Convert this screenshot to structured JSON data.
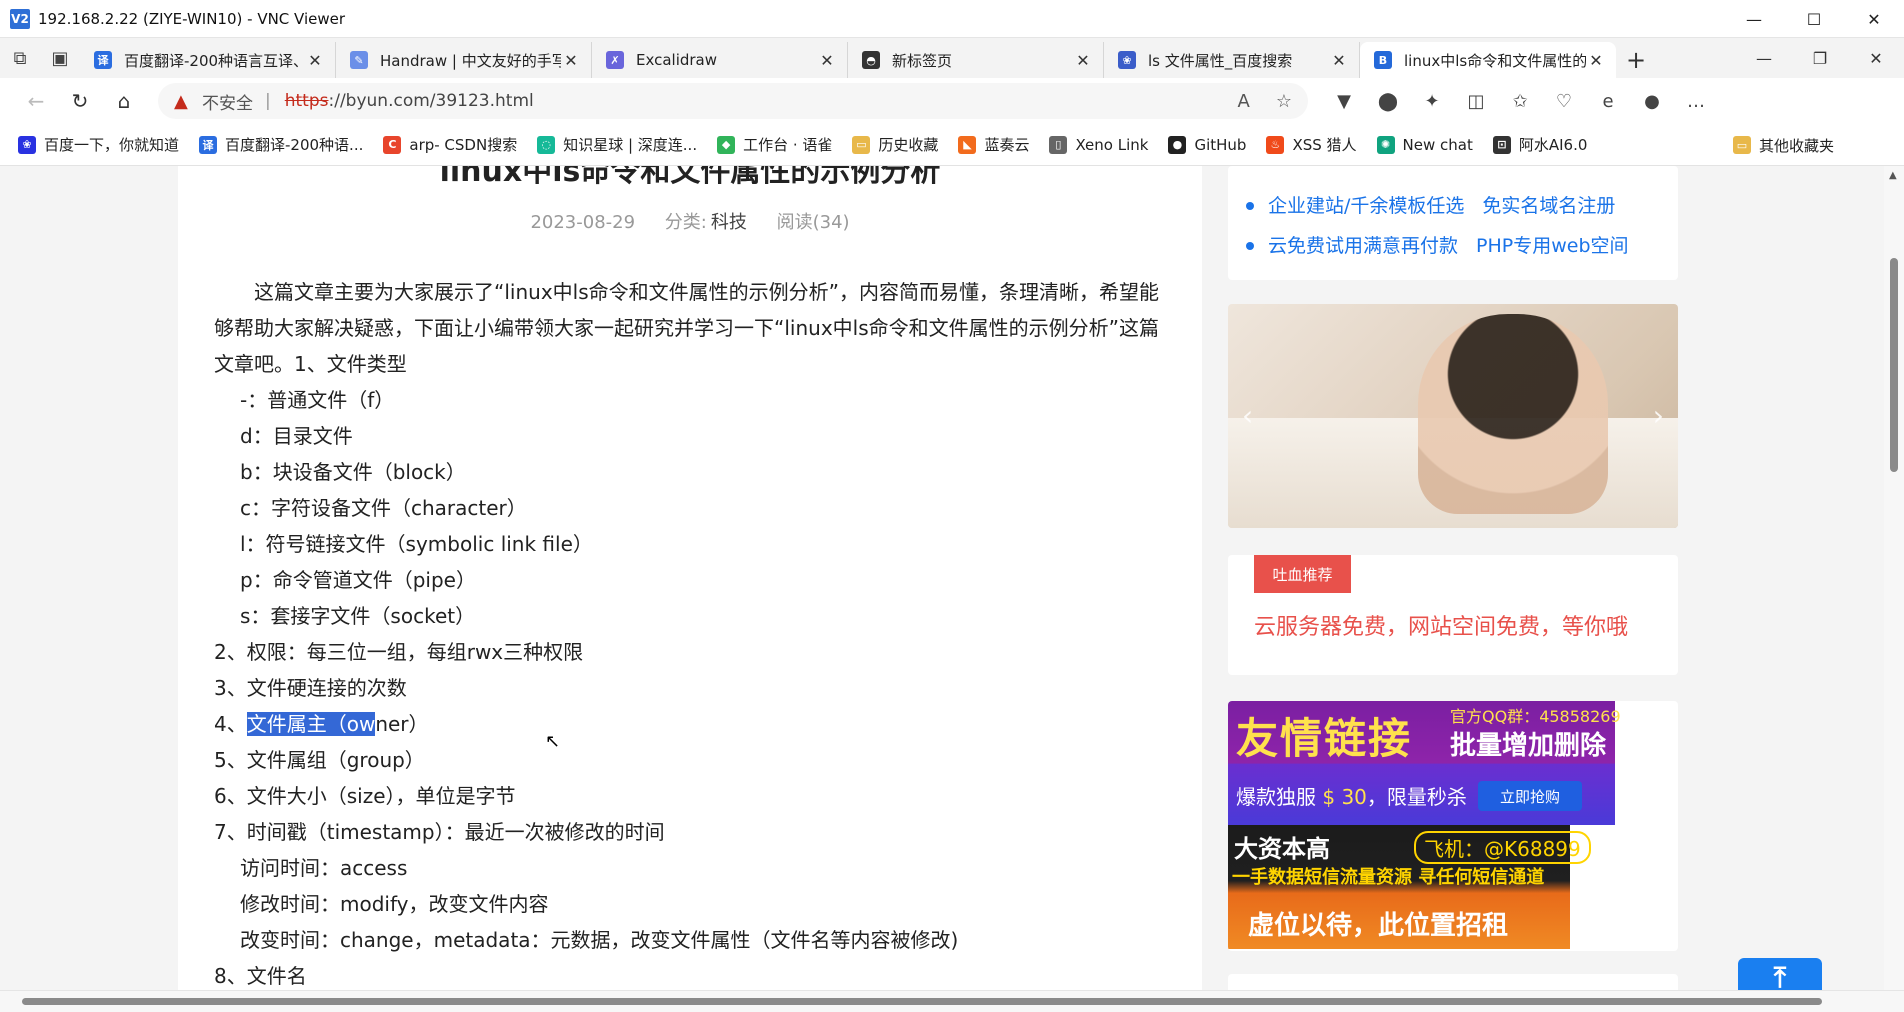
{
  "vnc": {
    "logo": "V2",
    "title": "192.168.2.22 (ZIYE-WIN10) - VNC Viewer",
    "minimize": "—",
    "maximize": "☐",
    "close": "✕"
  },
  "tabs": [
    {
      "label": "百度翻译-200种语言互译、",
      "fav": "译",
      "fav_color": "#2b6de0",
      "close": "✕"
    },
    {
      "label": "Handraw | 中文友好的手写",
      "fav": "✎",
      "fav_color": "#6b8fe8",
      "close": "✕"
    },
    {
      "label": "Excalidraw",
      "fav": "✗",
      "fav_color": "#6965db",
      "close": "✕"
    },
    {
      "label": "新标签页",
      "fav": "◓",
      "fav_color": "#333333",
      "close": "✕"
    },
    {
      "label": "ls 文件属性_百度搜索",
      "fav": "❀",
      "fav_color": "#3b5dc9",
      "close": "✕"
    },
    {
      "label": "linux中ls命令和文件属性的",
      "fav": "B",
      "fav_color": "#2469d9",
      "close": "✕"
    }
  ],
  "tabstrip": {
    "new_tab": "+",
    "minimize": "—",
    "restore": "❐",
    "close": "✕"
  },
  "toolbar": {
    "back": "←",
    "reload": "↻",
    "home": "⌂",
    "warning_icon": "▲",
    "insecure_label": "不安全",
    "separator": "|",
    "url_protocol": "https",
    "url_rest": "://byun.com/39123.html",
    "read_aloud": "A",
    "favorite": "☆",
    "extensions": [
      "▼",
      "⬤",
      "✦",
      "◫",
      "✩",
      "♡",
      "e",
      "●",
      "…"
    ]
  },
  "bookmarks": [
    {
      "label": "百度一下，你就知道",
      "ico": "❀",
      "color": "#2932e1"
    },
    {
      "label": "百度翻译-200种语...",
      "ico": "译",
      "color": "#2b6de0"
    },
    {
      "label": "arp- CSDN搜索",
      "ico": "C",
      "color": "#e8452c"
    },
    {
      "label": "知识星球 | 深度连...",
      "ico": "◌",
      "color": "#16b998"
    },
    {
      "label": "工作台 · 语雀",
      "ico": "◆",
      "color": "#31b45a"
    },
    {
      "label": "历史收藏",
      "ico": "▭",
      "color": "#e8b84a"
    },
    {
      "label": "蓝奏云",
      "ico": "◣",
      "color": "#f26b1d"
    },
    {
      "label": "Xeno Link",
      "ico": "▯",
      "color": "#666666"
    },
    {
      "label": "GitHub",
      "ico": "●",
      "color": "#222222"
    },
    {
      "label": "XSS 猎人",
      "ico": "♨",
      "color": "#f04a1a"
    },
    {
      "label": "New chat",
      "ico": "✺",
      "color": "#10a37f"
    },
    {
      "label": "阿水AI6.0",
      "ico": "⊡",
      "color": "#333333"
    }
  ],
  "bookmarks_other": {
    "label": "其他收藏夹",
    "ico": "▭",
    "color": "#e8b84a"
  },
  "article": {
    "title": "linux中ls命令和文件属性的示例分析",
    "date": "2023-08-29",
    "category_label": "分类:",
    "category": "科技",
    "reads": "阅读(34)",
    "intro": "这篇文章主要为大家展示了“linux中ls命令和文件属性的示例分析”，内容简而易懂，条理清晰，希望能够帮助大家解决疑惑，下面让小编带领大家一起研究并学习一下“linux中ls命令和文件属性的示例分析”这篇文章吧。1、文件类型",
    "types": [
      "-：普通文件（f）",
      "d：目录文件",
      "b：块设备文件（block）",
      "c：字符设备文件（character）",
      "l：符号链接文件（symbolic link file）",
      "p：命令管道文件（pipe）",
      "s：套接字文件（socket）"
    ],
    "line2": "2、权限：每三位一组，每组rwx三种权限",
    "line3": "3、文件硬连接的次数",
    "line4_prefix": "4、",
    "line4_selected": "文件属主（ow",
    "line4_rest": "ner）",
    "line5": "5、文件属组（group）",
    "line6": "6、文件大小（size），单位是字节",
    "line7": "7、时间戳（timestamp）：最近一次被修改的时间",
    "times": [
      "访问时间：access",
      "修改时间：modify，改变文件内容",
      "改变时间：change，metadata：元数据，改变文件属性（文件名等内容被修改)"
    ],
    "line8": "8、文件名"
  },
  "sidebar": {
    "links_row1": [
      "企业建站/千余模板任选",
      "免实名域名注册"
    ],
    "links_row2": [
      "云免费试用满意再付款",
      "PHP专用web空间"
    ],
    "carousel_prev": "‹",
    "carousel_next": "›",
    "recommend_badge": "吐血推荐",
    "recommend_text": "云服务器免费，网站空间免费，等你哦",
    "ad1": {
      "big": "友情链接",
      "qq": "官方QQ群：45858269",
      "batch": "批量增加删除",
      "promo_a": "爆款独服 ",
      "promo_hl": "$ 30",
      "promo_b": "，限量秒杀",
      "button": "立即抢购"
    },
    "ad2": {
      "t1": "大资本高",
      "t2": "飞机：@K68899",
      "t3": "一手数据短信流量资源 寻任何短信通道",
      "t4": "虚位以待，此位置招租"
    },
    "to_top": "⤒"
  }
}
